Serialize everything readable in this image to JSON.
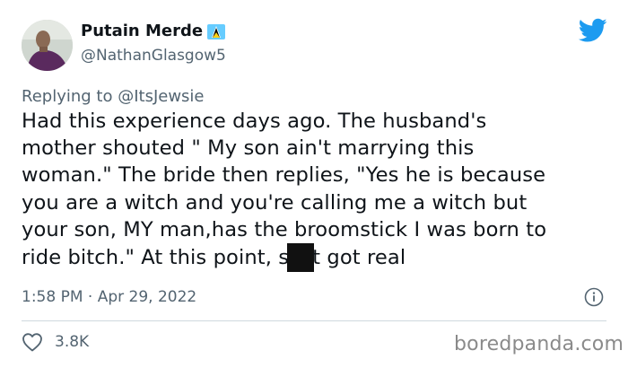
{
  "author": {
    "display_name": "Putain Merde",
    "handle": "@NathanGlasgow5",
    "flag_icon": "saint-lucia-flag-icon"
  },
  "brand_icon": "twitter-bird-icon",
  "reply": {
    "prefix": "Replying to ",
    "mention": "@ItsJewsie"
  },
  "tweet": {
    "lines": [
      "Had this experience days ago. The husband's",
      "mother shouted \" My son ain't marrying this",
      "woman.\" The bride then replies, \"Yes he is because",
      "you are a witch and you're calling me a witch but",
      "your son, MY man,has the broomstick I was born to"
    ],
    "last_line_before": "ride bitch.\" At this point, s",
    "last_line_after": "t got real"
  },
  "timestamp": "1:58 PM · Apr 29, 2022",
  "likes": "3.8K",
  "watermark": "boredpanda.com",
  "colors": {
    "twitter_blue": "#1d9bf0",
    "secondary_text": "#536471",
    "divider": "#cfd9de",
    "watermark": "#8a8a8a"
  }
}
